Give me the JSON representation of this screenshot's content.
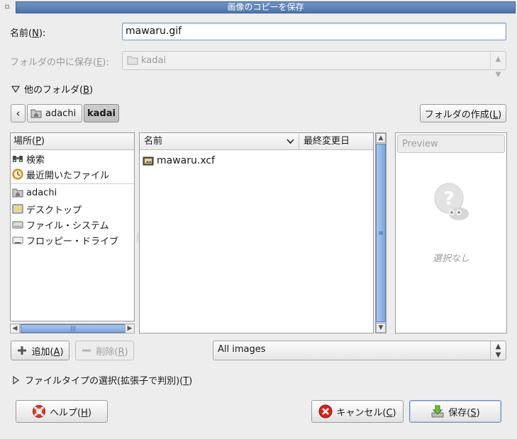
{
  "window": {
    "title": "画像のコピーを保存",
    "menu_glyph": "▫"
  },
  "name_row": {
    "label": "名前(",
    "mnemonic": "N",
    "label_end": "):",
    "value": "mawaru.gif"
  },
  "save_in_row": {
    "label": "フォルダの中に保存(",
    "mnemonic": "E",
    "label_end": "):",
    "value": "kadai"
  },
  "other_folders": {
    "label": "他のフォルダ(",
    "mnemonic": "B",
    "label_end": ")"
  },
  "pathbar": {
    "back_glyph": "‹",
    "items": [
      "adachi",
      "kadai"
    ]
  },
  "create_folder_button": {
    "label": "フォルダの作成(",
    "mnemonic": "L",
    "label_end": ")"
  },
  "places": {
    "header": "場所(",
    "mnemonic": "P",
    "header_end": ")",
    "items": [
      "検索",
      "最近開いたファイル",
      "adachi",
      "デスクトップ",
      "ファイル・システム",
      "フロッピー・ドライブ"
    ]
  },
  "files": {
    "col_name": "名前",
    "col_modified": "最終変更日",
    "rows": [
      {
        "name": "mawaru.xcf"
      }
    ]
  },
  "preview": {
    "button": "Preview",
    "empty_text": "選択なし"
  },
  "add_button": {
    "label": "追加(",
    "mnemonic": "A",
    "label_end": ")"
  },
  "remove_button": {
    "label": "削除(",
    "mnemonic": "R",
    "label_end": ")"
  },
  "filter": {
    "value": "All images"
  },
  "file_type": {
    "label": "ファイルタイプの選択(拡張子で判別)(",
    "mnemonic": "T",
    "label_end": ")"
  },
  "help_button": {
    "label": "ヘルプ(",
    "mnemonic": "H",
    "label_end": ")"
  },
  "cancel_button": {
    "label": "キャンセル(",
    "mnemonic": "C",
    "label_end": ")"
  },
  "save_button": {
    "label": "保存(",
    "mnemonic": "S",
    "label_end": ")"
  },
  "colors": {
    "titlebar": "#5a7fb3",
    "scrollbar": "#8eb1df",
    "entry_border": "#7a99c6"
  }
}
